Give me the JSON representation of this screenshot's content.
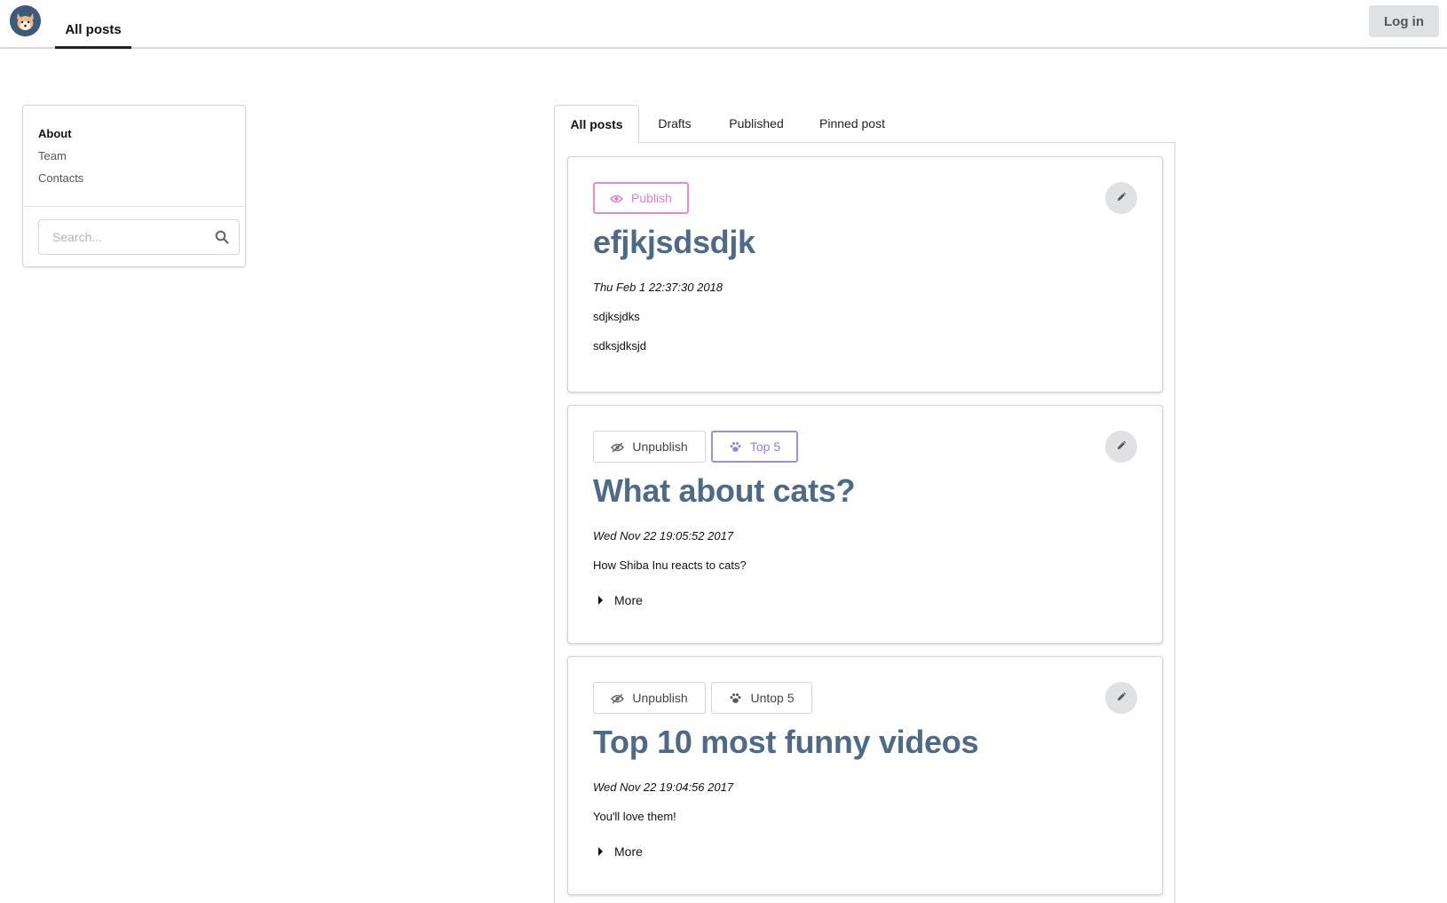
{
  "topbar": {
    "nav_label": "All posts",
    "login_label": "Log in"
  },
  "sidebar": {
    "items": [
      {
        "label": "About"
      },
      {
        "label": "Team"
      },
      {
        "label": "Contacts"
      }
    ],
    "search_placeholder": "Search..."
  },
  "tabs": [
    {
      "label": "All posts"
    },
    {
      "label": "Drafts"
    },
    {
      "label": "Published"
    },
    {
      "label": "Pinned post"
    }
  ],
  "posts": [
    {
      "actions": [
        {
          "label": "Publish",
          "icon": "eye-icon",
          "color": "#e87fcb"
        }
      ],
      "title": "efjkjsdsdjk",
      "date": "Thu Feb 1 22:37:30 2018",
      "lines": [
        "sdjksjdks",
        "sdksjdksjd"
      ]
    },
    {
      "actions": [
        {
          "label": "Unpublish",
          "icon": "eye-slash-icon"
        },
        {
          "label": "Top 5",
          "icon": "paw-icon",
          "color": "#8d82dd"
        }
      ],
      "title": "What about cats?",
      "date": "Wed Nov 22 19:05:52 2017",
      "lines": [
        "How Shiba Inu reacts to cats?"
      ],
      "more_label": "More"
    },
    {
      "actions": [
        {
          "label": "Unpublish",
          "icon": "eye-slash-icon"
        },
        {
          "label": "Untop 5",
          "icon": "paw-icon"
        }
      ],
      "title": "Top 10 most funny videos",
      "date": "Wed Nov 22 19:04:56 2017",
      "lines": [
        "You'll love them!"
      ],
      "more_label": "More"
    }
  ],
  "colors": {
    "title": "#4d6a88",
    "publish": "#e87fcb",
    "top5": "#8d82dd",
    "logo": "#3d5a78"
  }
}
